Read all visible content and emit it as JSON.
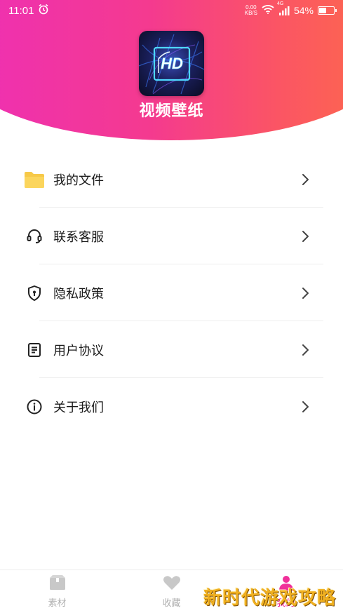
{
  "status_bar": {
    "time": "11:01",
    "net_speed_value": "0.00",
    "net_speed_unit": "KB/S",
    "network_type": "4G",
    "battery_percent": "54%",
    "battery_level": 0.54
  },
  "app": {
    "logo_text": "HD",
    "name": "视频壁纸"
  },
  "menu": {
    "items": [
      {
        "label": "我的文件",
        "icon": "folder-icon"
      },
      {
        "label": "联系客服",
        "icon": "headset-icon"
      },
      {
        "label": "隐私政策",
        "icon": "shield-icon"
      },
      {
        "label": "用户协议",
        "icon": "document-icon"
      },
      {
        "label": "关于我们",
        "icon": "info-icon"
      }
    ]
  },
  "tabbar": {
    "tabs": [
      {
        "label": "素材",
        "icon": "box-icon",
        "active": false
      },
      {
        "label": "收藏",
        "icon": "heart-icon",
        "active": false
      },
      {
        "label": "我的",
        "icon": "user-icon",
        "active": true
      }
    ]
  },
  "watermark": "新时代游戏攻略",
  "colors": {
    "gradient_start": "#ee2fb6",
    "gradient_end": "#fd6a4a",
    "active_tab": "#f0309a",
    "folder": "#f7c948"
  }
}
